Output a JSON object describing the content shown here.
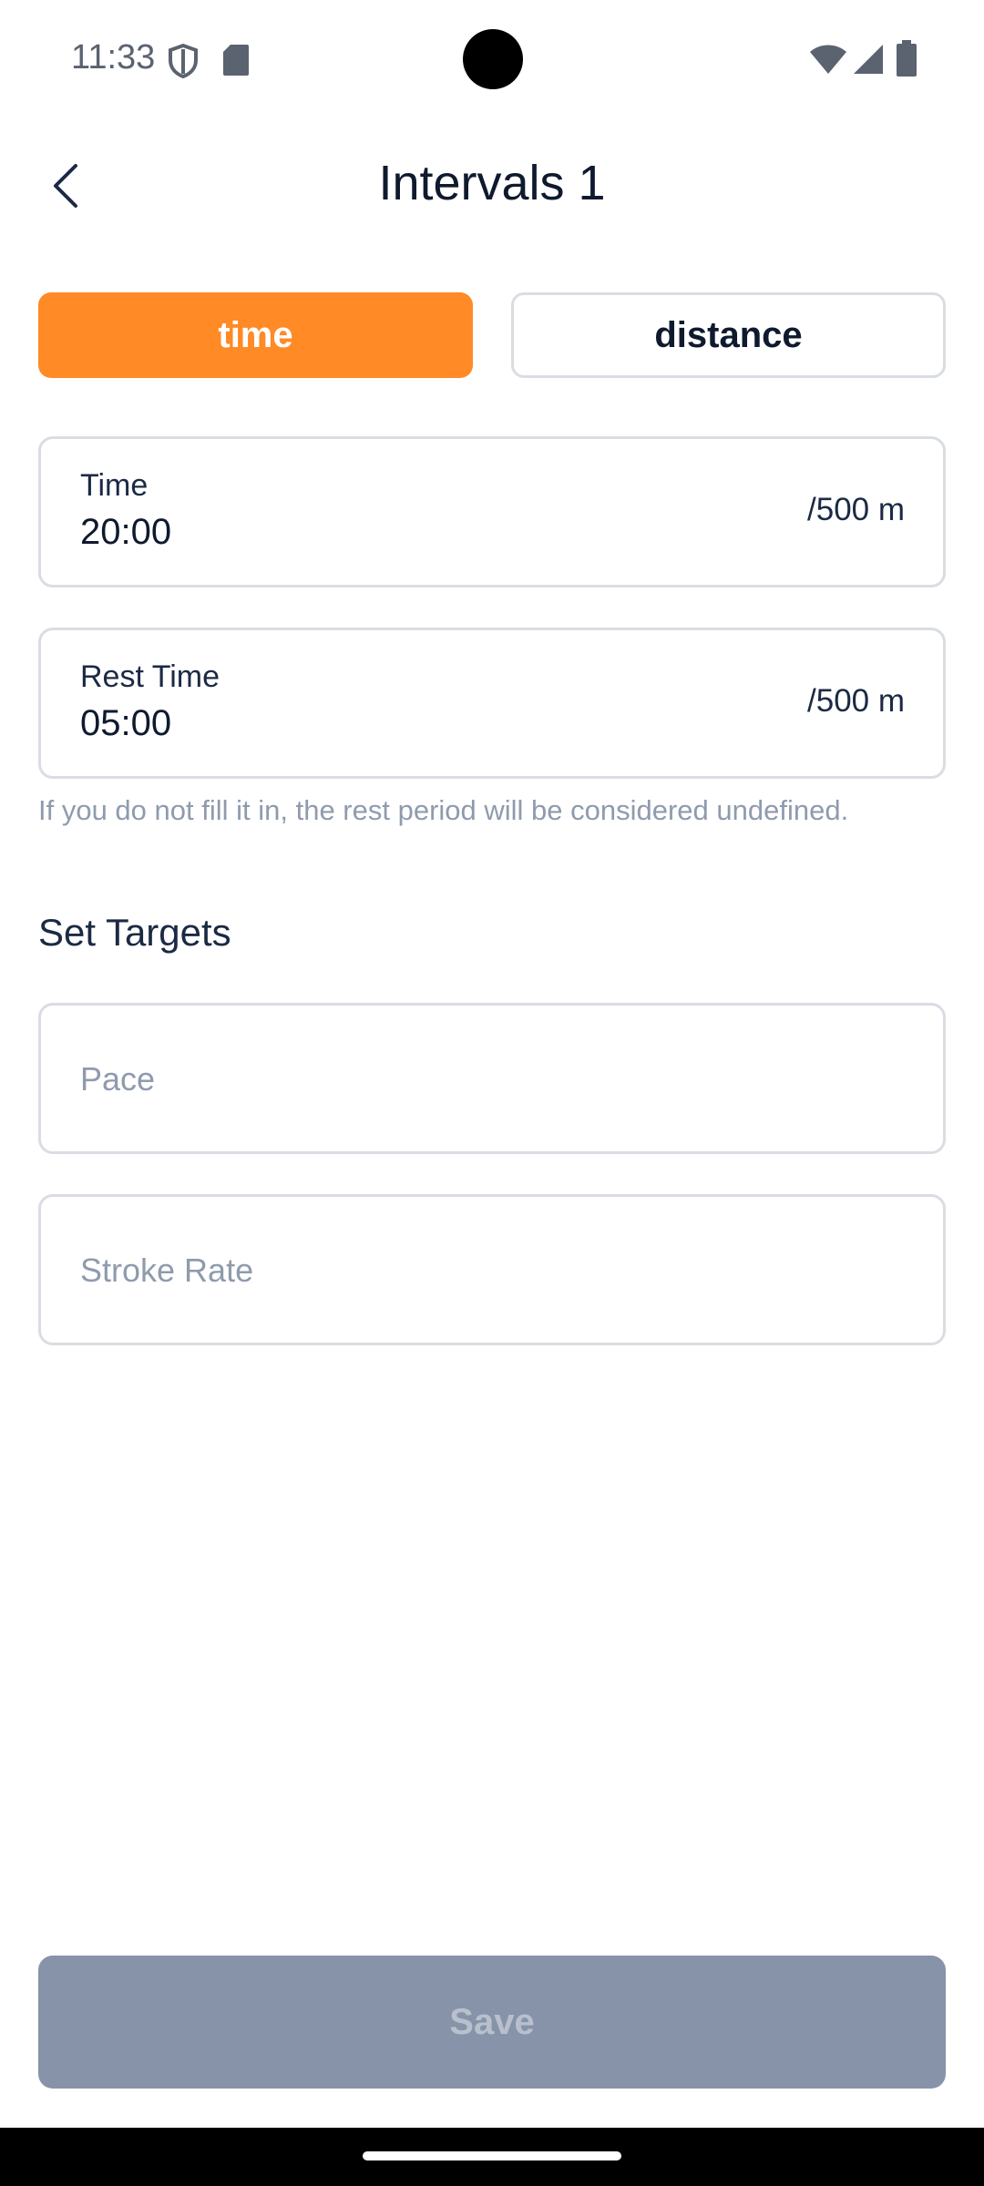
{
  "status_bar": {
    "time": "11:33",
    "icons": [
      "shield-icon",
      "sd-card-icon",
      "wifi-icon",
      "signal-icon",
      "battery-icon"
    ]
  },
  "header": {
    "title": "Intervals 1",
    "back_icon": "chevron-left-icon"
  },
  "mode_toggle": {
    "options": [
      "time",
      "distance"
    ],
    "selected": "time",
    "active_color": "#ff8a26"
  },
  "fields": {
    "time": {
      "label": "Time",
      "value": "20:00",
      "unit": "/500 m"
    },
    "rest_time": {
      "label": "Rest Time",
      "value": "05:00",
      "unit": "/500 m"
    },
    "rest_hint": "If you do not fill it in, the rest period will be considered undefined."
  },
  "targets": {
    "title": "Set Targets",
    "pace_placeholder": "Pace",
    "stroke_rate_placeholder": "Stroke Rate"
  },
  "footer": {
    "save_label": "Save"
  }
}
